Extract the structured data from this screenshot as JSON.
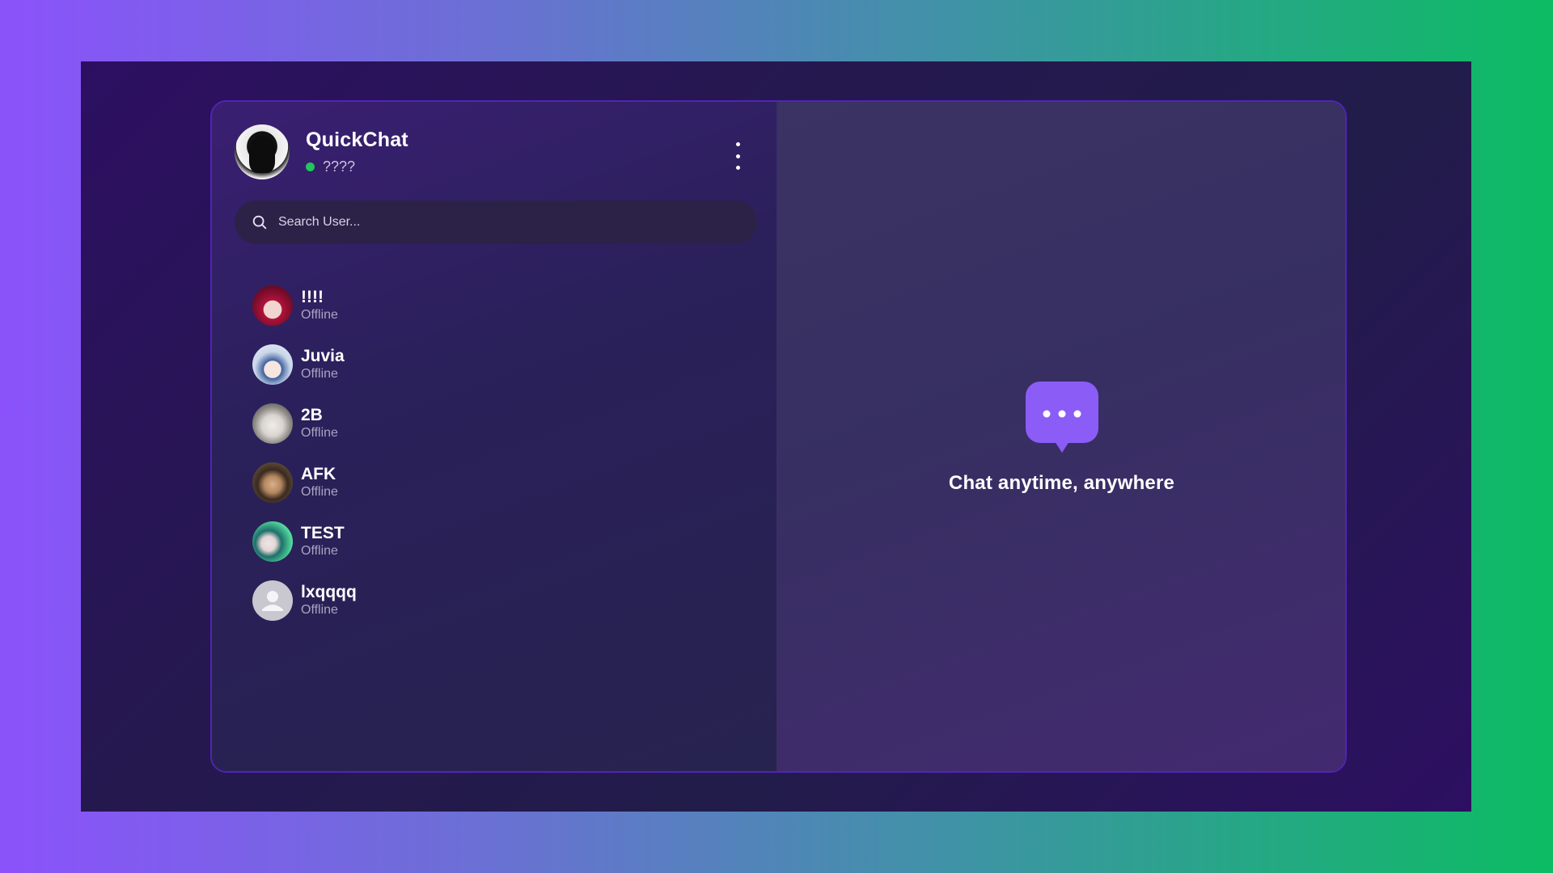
{
  "app": {
    "name": "QuickChat",
    "status_text": "????",
    "status_color": "#22c55e"
  },
  "search": {
    "placeholder": "Search User..."
  },
  "users": [
    {
      "name": "!!!!",
      "status": "Offline",
      "avatar": "anime-red-hair-avatar"
    },
    {
      "name": "Juvia",
      "status": "Offline",
      "avatar": "anime-blue-hair-avatar"
    },
    {
      "name": "2B",
      "status": "Offline",
      "avatar": "anime-white-hair-avatar"
    },
    {
      "name": "AFK",
      "status": "Offline",
      "avatar": "anime-dark-hair-avatar"
    },
    {
      "name": "TEST",
      "status": "Offline",
      "avatar": "anime-green-hair-avatar"
    },
    {
      "name": "lxqqqq",
      "status": "Offline",
      "avatar": "default-user-avatar"
    }
  ],
  "main": {
    "icon": "chat-bubble-icon",
    "tagline": "Chat anytime, anywhere",
    "accent_color": "#8b5cf6"
  }
}
